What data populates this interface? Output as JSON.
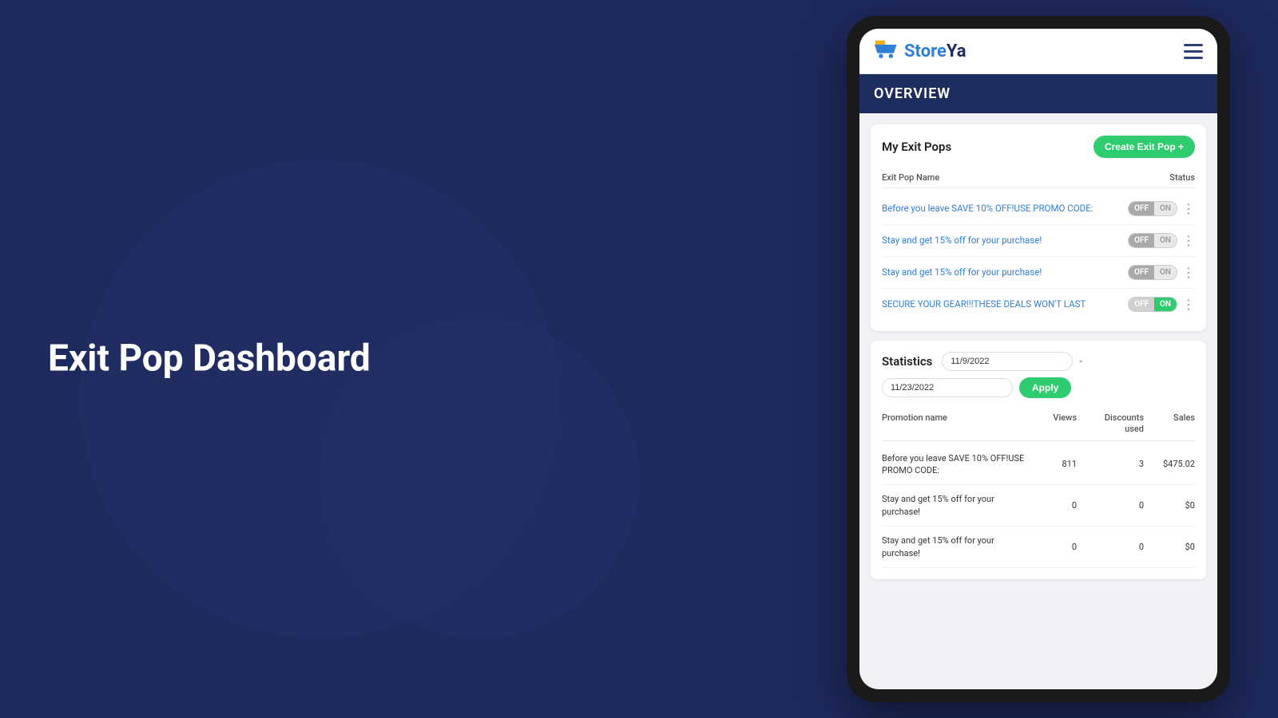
{
  "background": {
    "color": "#1e2a5e"
  },
  "left_section": {
    "heading": "Exit Pop Dashboard"
  },
  "app": {
    "logo": {
      "text_part1": "Store",
      "text_part2": "Ya",
      "full": "StoreYa"
    },
    "overview_bar": {
      "title": "OVERVIEW"
    },
    "exit_pops": {
      "section_title": "My Exit Pops",
      "create_button": "Create Exit Pop +",
      "table_header": {
        "name": "Exit Pop Name",
        "status": "Status"
      },
      "rows": [
        {
          "name": "Before you leave SAVE 10% OFF!USE PROMO CODE:",
          "status": "off",
          "id": "row-1"
        },
        {
          "name": "Stay and get 15% off for your purchase!",
          "status": "off",
          "id": "row-2"
        },
        {
          "name": "Stay and get 15% off for your purchase!",
          "status": "off",
          "id": "row-3"
        },
        {
          "name": "SECURE YOUR GEAR!!!THESE DEALS WON'T LAST",
          "status": "on",
          "id": "row-4"
        }
      ]
    },
    "statistics": {
      "title": "Statistics",
      "date_from": "11/9/2022",
      "date_to": "11/23/2022",
      "apply_button": "Apply",
      "table_headers": {
        "promotion_name": "Promotion name",
        "views": "Views",
        "discounts_used": "Discounts used",
        "sales": "Sales"
      },
      "rows": [
        {
          "name": "Before you leave SAVE 10% OFF!USE PROMO CODE:",
          "views": "811",
          "discounts_used": "3",
          "sales": "$475.02"
        },
        {
          "name": "Stay and get 15% off for your purchase!",
          "views": "0",
          "discounts_used": "0",
          "sales": "$0"
        },
        {
          "name": "Stay and get 15% off for your purchase!",
          "views": "0",
          "discounts_used": "0",
          "sales": "$0"
        }
      ]
    }
  }
}
